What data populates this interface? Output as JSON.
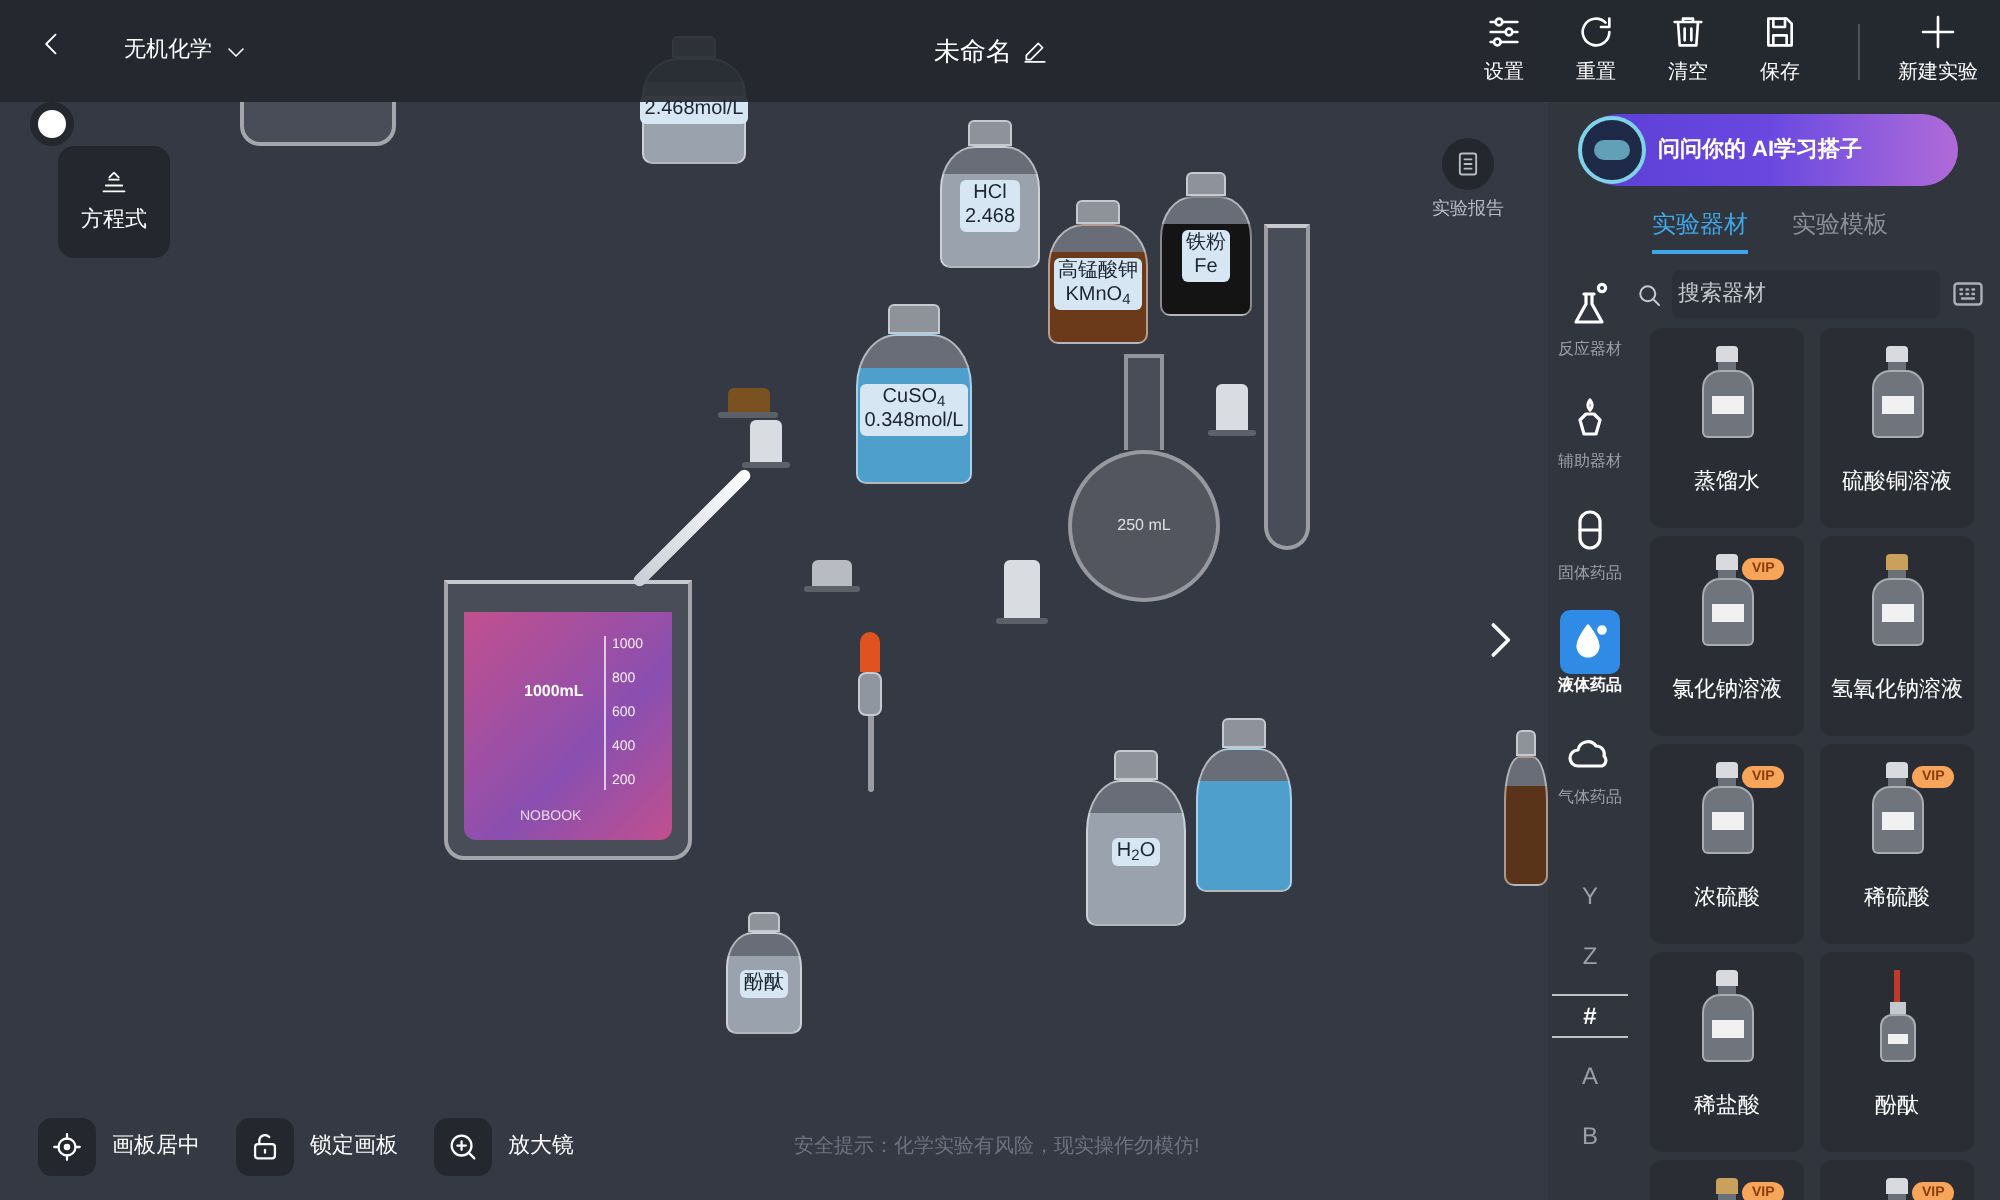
{
  "top_bar": {
    "subject": "无机化学",
    "title": "未命名",
    "actions": [
      {
        "label": "设置"
      },
      {
        "label": "重置"
      },
      {
        "label": "清空"
      },
      {
        "label": "保存"
      },
      {
        "label": "新建实验"
      }
    ]
  },
  "equation_button": {
    "label": "方程式"
  },
  "report_button": {
    "label": "实验报告"
  },
  "canvas_items": [
    {
      "kind": "glass-base"
    },
    {
      "kind": "bottle",
      "color": "#9aa3ad",
      "labels": [
        "2.468mol/L"
      ]
    },
    {
      "kind": "bottle",
      "color": "#9aa3ad",
      "labels": [
        "HCl",
        "2.468"
      ]
    },
    {
      "kind": "bottle",
      "color": "#6b3a1a",
      "labels": [
        "高锰酸钾",
        "KMnO$_{4}$"
      ]
    },
    {
      "kind": "bottle",
      "color": "#141414",
      "labels": [
        "铁粉",
        "Fe"
      ]
    },
    {
      "kind": "test-tube"
    },
    {
      "kind": "stopper",
      "color": "#7a5222"
    },
    {
      "kind": "stopper",
      "color": "#d9dde2"
    },
    {
      "kind": "bottle",
      "color": "#4f9fcc",
      "labels": [
        "CuSO$_{4}$",
        "0.348mol/L"
      ]
    },
    {
      "kind": "flask",
      "label": "250 mL"
    },
    {
      "kind": "stopper",
      "color": "#d9dde2"
    },
    {
      "kind": "beaker",
      "color": "#c1508e",
      "volume_label": "1000mL",
      "scale": [
        "1000",
        "800",
        "600",
        "400",
        "200"
      ],
      "marking": "NOBOOK"
    },
    {
      "kind": "glass-rod"
    },
    {
      "kind": "stopper",
      "color": "#b8bcc2"
    },
    {
      "kind": "stopper",
      "color": "#d9dde2"
    },
    {
      "kind": "dropper"
    },
    {
      "kind": "bottle",
      "color": "#4f9fcc"
    },
    {
      "kind": "bottle",
      "color": "#9aa3ad",
      "labels": [
        "H$_{2}$O"
      ]
    },
    {
      "kind": "bottle",
      "color": "#9aa3ad",
      "labels": [
        "酚酞"
      ]
    },
    {
      "kind": "bottle",
      "color": "#5a3418"
    }
  ],
  "ai_banner": {
    "text": "问问你的 AI学习搭子"
  },
  "tabs": [
    {
      "label": "实验器材",
      "selected": true
    },
    {
      "label": "实验模板",
      "selected": false
    }
  ],
  "search": {
    "placeholder": "搜索器材"
  },
  "categories": [
    {
      "label": "反应器材",
      "selected": false
    },
    {
      "label": "辅助器材",
      "selected": false
    },
    {
      "label": "固体药品",
      "selected": false
    },
    {
      "label": "液体药品",
      "selected": true
    },
    {
      "label": "气体药品",
      "selected": false
    }
  ],
  "index_letters": [
    {
      "label": "Y",
      "selected": false
    },
    {
      "label": "Z",
      "selected": false
    },
    {
      "label": "#",
      "selected": true
    },
    {
      "label": "A",
      "selected": false
    },
    {
      "label": "B",
      "selected": false
    }
  ],
  "materials": [
    {
      "kind": "bottle",
      "color": "#d8dadd",
      "label": "蒸馏水"
    },
    {
      "kind": "bottle",
      "color": "#d8dadd",
      "label": "硫酸铜溶液"
    },
    {
      "kind": "bottle",
      "color": "#d8dadd",
      "label": "氯化钠溶液",
      "badge": "VIP"
    },
    {
      "kind": "bottle",
      "color": "#c9a05c",
      "label": "氢氧化钠溶液"
    },
    {
      "kind": "bottle",
      "color": "#d8dadd",
      "label": "浓硫酸",
      "badge": "VIP"
    },
    {
      "kind": "bottle",
      "color": "#d8dadd",
      "label": "稀硫酸",
      "badge": "VIP"
    },
    {
      "kind": "bottle",
      "color": "#d8dadd",
      "label": "稀盐酸"
    },
    {
      "kind": "dropper-bottle",
      "color": "#c0392b",
      "label": "酚酞"
    },
    {
      "kind": "bottle",
      "color": "#c9a05c",
      "badge": "VIP"
    },
    {
      "kind": "bottle",
      "color": "#d8dadd",
      "badge": "VIP"
    }
  ],
  "bottom_tools": [
    {
      "label": "画板居中"
    },
    {
      "label": "锁定画板"
    },
    {
      "label": "放大镜"
    }
  ],
  "safety_tip": "安全提示：化学实验有风险，现实操作勿模仿!"
}
